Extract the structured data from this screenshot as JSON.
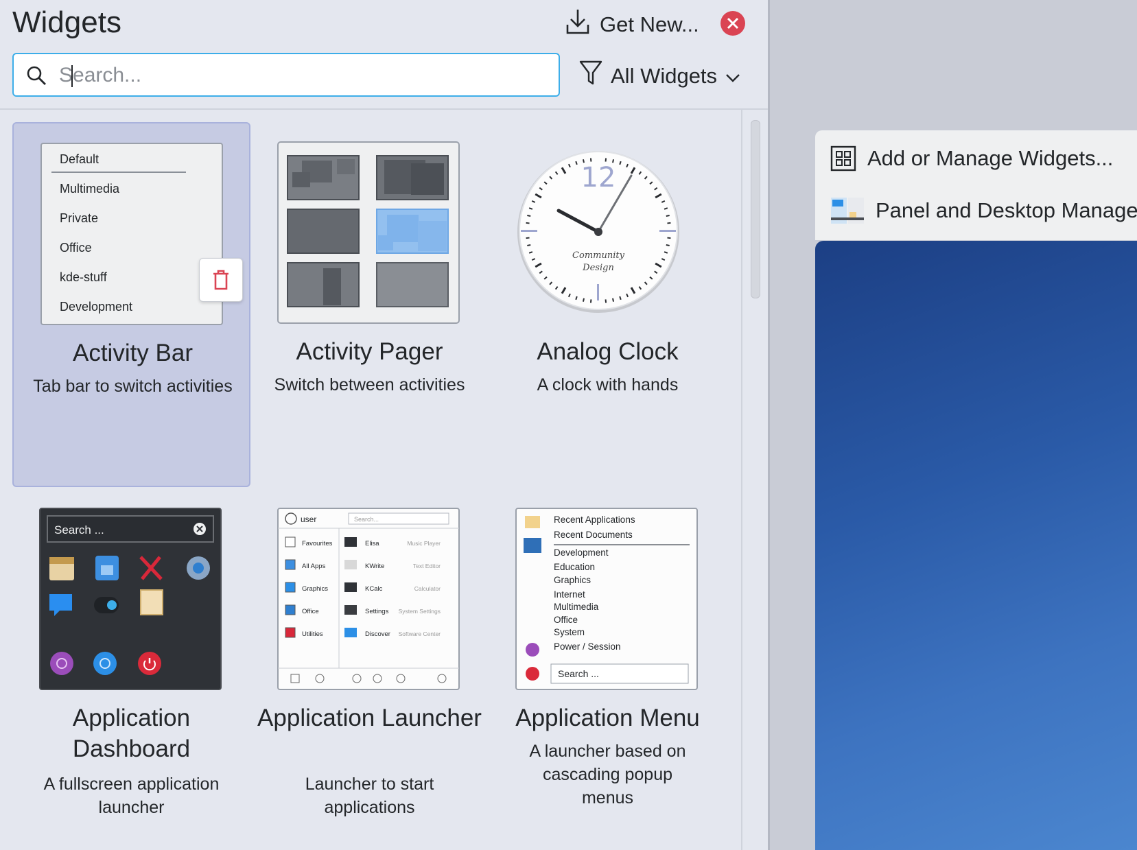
{
  "header": {
    "title": "Widgets",
    "get_new_label": "Get New...",
    "search_placeholder": "Search...",
    "filter_label": "All Widgets"
  },
  "widgets": [
    {
      "name": "Activity Bar",
      "description": "Tab bar to switch activities",
      "selected": true
    },
    {
      "name": "Activity Pager",
      "description": "Switch between activities"
    },
    {
      "name": "Analog Clock",
      "description": "A clock with hands"
    },
    {
      "name": "Application Dashboard",
      "description": "A fullscreen application launcher"
    },
    {
      "name": "Application Launcher",
      "description": "Launcher to start applications"
    },
    {
      "name": "Application Menu",
      "description": "A launcher based on cascading popup menus"
    }
  ],
  "activity_bar_preview": {
    "items": [
      "Default",
      "Multimedia",
      "Private",
      "Office",
      "kde-stuff",
      "Development"
    ]
  },
  "clock_preview": {
    "number": "12",
    "brand": "Community",
    "brand2": "Design"
  },
  "dashboard_preview": {
    "search": "Search ..."
  },
  "launcher_preview": {
    "user": "user",
    "search": "Search...",
    "left": [
      "Favourites",
      "All Apps",
      "Graphics",
      "Office",
      "Utilities"
    ],
    "right": [
      {
        "app": "Elisa",
        "desc": "Music Player"
      },
      {
        "app": "KWrite",
        "desc": "Text Editor"
      },
      {
        "app": "KCalc",
        "desc": "Calculator"
      },
      {
        "app": "Settings",
        "desc": "System Settings"
      },
      {
        "app": "Discover",
        "desc": "Software Center"
      }
    ]
  },
  "menu_preview": {
    "top": [
      "Recent Applications",
      "Recent Documents"
    ],
    "cats": [
      "Development",
      "Education",
      "Graphics",
      "Internet",
      "Multimedia",
      "Office",
      "System",
      "Power / Session"
    ],
    "search": "Search ..."
  },
  "context_menu": {
    "items": [
      "Add or Manage Widgets...",
      "Panel and Desktop Managem"
    ]
  },
  "colors": {
    "accent": "#3daee9",
    "selection": "#c6cbe3",
    "close": "#da4453"
  }
}
